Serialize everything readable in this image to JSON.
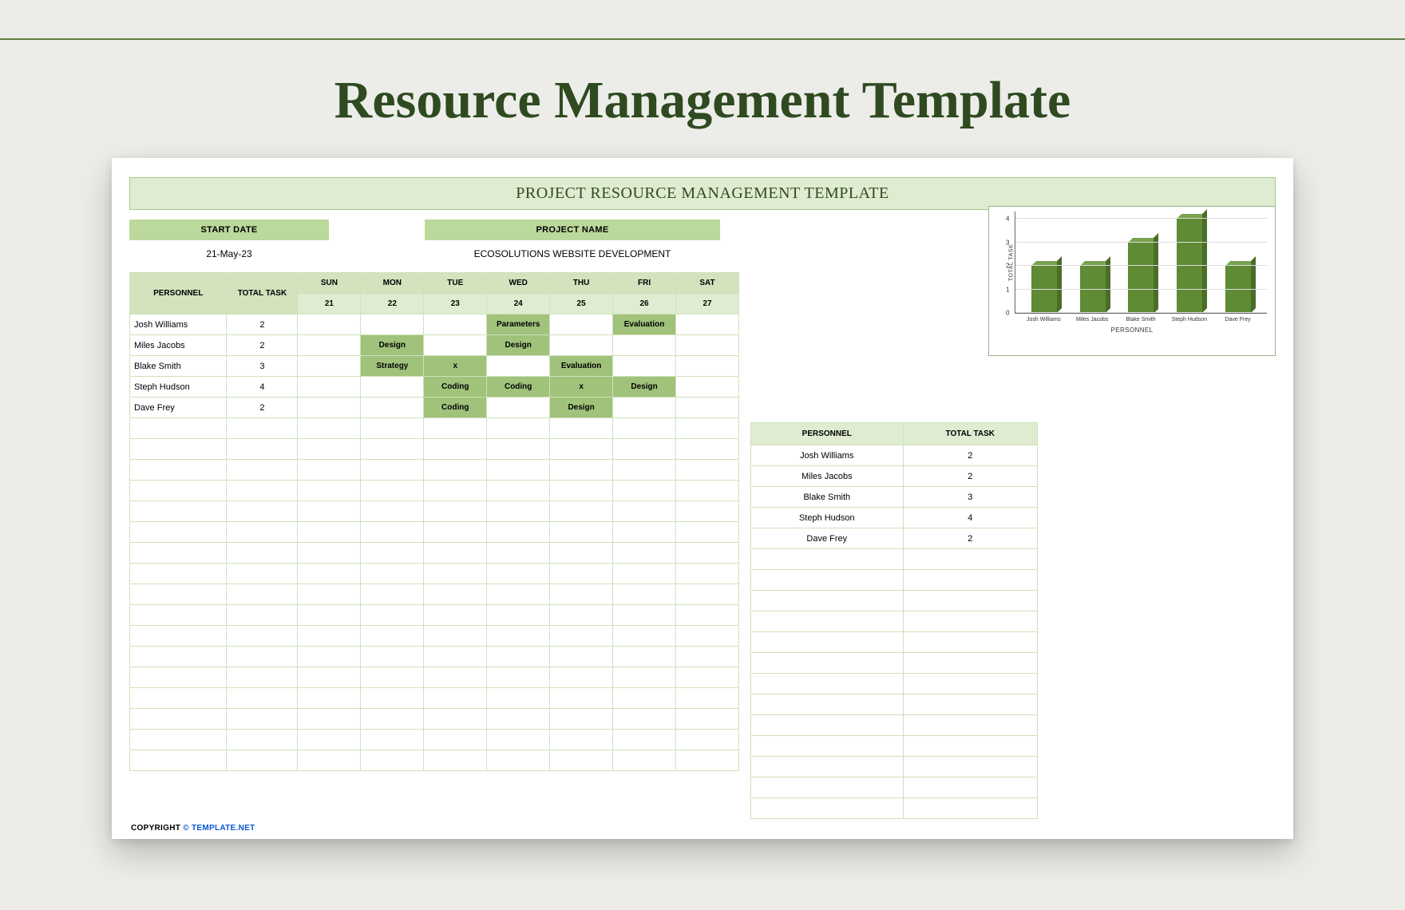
{
  "page_title": "Resource Management Template",
  "banner": "PROJECT RESOURCE MANAGEMENT TEMPLATE",
  "meta": {
    "start_date_label": "START DATE",
    "start_date_value": "21-May-23",
    "project_name_label": "PROJECT NAME",
    "project_name_value": "ECOSOLUTIONS WEBSITE DEVELOPMENT"
  },
  "schedule": {
    "headers": {
      "personnel": "PERSONNEL",
      "total": "TOTAL TASK"
    },
    "days": [
      {
        "name": "SUN",
        "num": "21"
      },
      {
        "name": "MON",
        "num": "22"
      },
      {
        "name": "TUE",
        "num": "23"
      },
      {
        "name": "WED",
        "num": "24"
      },
      {
        "name": "THU",
        "num": "25"
      },
      {
        "name": "FRI",
        "num": "26"
      },
      {
        "name": "SAT",
        "num": "27"
      }
    ],
    "rows": [
      {
        "name": "Josh Williams",
        "total": 2,
        "cells": [
          "",
          "",
          "",
          "Parameters",
          "",
          "Evaluation",
          ""
        ]
      },
      {
        "name": "Miles Jacobs",
        "total": 2,
        "cells": [
          "",
          "Design",
          "",
          "Design",
          "",
          "",
          ""
        ]
      },
      {
        "name": "Blake Smith",
        "total": 3,
        "cells": [
          "",
          "Strategy",
          "x",
          "",
          "Evaluation",
          "",
          ""
        ]
      },
      {
        "name": "Steph Hudson",
        "total": 4,
        "cells": [
          "",
          "",
          "Coding",
          "Coding",
          "x",
          "Design",
          ""
        ]
      },
      {
        "name": "Dave Frey",
        "total": 2,
        "cells": [
          "",
          "",
          "Coding",
          "",
          "Design",
          "",
          ""
        ]
      }
    ],
    "blank_rows": 17
  },
  "summary": {
    "headers": {
      "personnel": "PERSONNEL",
      "total": "TOTAL TASK"
    },
    "rows": [
      {
        "name": "Josh Williams",
        "total": 2
      },
      {
        "name": "Miles Jacobs",
        "total": 2
      },
      {
        "name": "Blake Smith",
        "total": 3
      },
      {
        "name": "Steph Hudson",
        "total": 4
      },
      {
        "name": "Dave Frey",
        "total": 2
      }
    ],
    "blank_rows": 13
  },
  "chart_data": {
    "type": "bar",
    "categories": [
      "Josh Williams",
      "Miles Jacobs",
      "Blake Smith",
      "Steph Hudson",
      "Dave Frey"
    ],
    "values": [
      2,
      2,
      3,
      4,
      2
    ],
    "title": "",
    "xlabel": "PERSONNEL",
    "ylabel": "TOTAL TASK",
    "ylim": [
      0,
      4
    ],
    "yticks": [
      0,
      1,
      2,
      3,
      4
    ]
  },
  "copyright": {
    "prefix": "COPYRIGHT ",
    "link": "© TEMPLATE.NET"
  }
}
